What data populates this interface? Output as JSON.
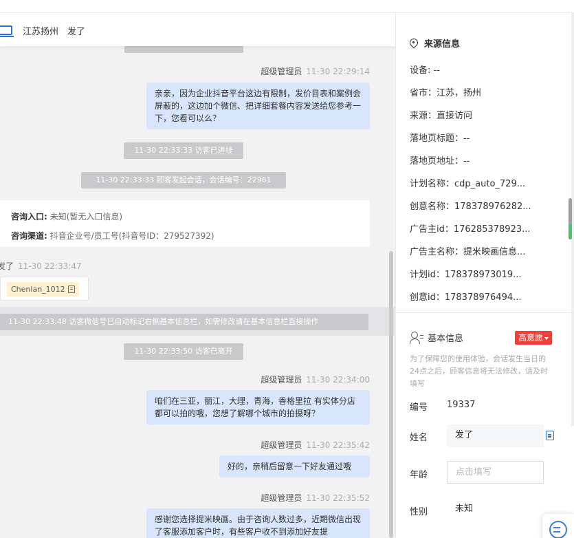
{
  "chat": {
    "header": {
      "source": "江苏扬州",
      "name": "发了"
    },
    "messages": [
      {
        "sender": "超级管理员",
        "time": "11-30 22:29:14",
        "text": "亲亲，因为企业抖音平台这边有限制，发价目表和案例会屏蔽的，这边加个微信、把详细套餐内容发送给您参考一下，您看可以么？"
      },
      {
        "sender": "超级管理员",
        "time": "11-30 22:34:00",
        "text": "咱们在三亚，丽江，大理，青海，香格里拉 有实体分店都可以拍的哦，您想了解哪个城市的拍摄呀？"
      },
      {
        "sender": "超级管理员",
        "time": "11-30 22:35:42",
        "text": "好的，亲稍后留意一下好友通过哦"
      },
      {
        "sender": "超级管理员",
        "time": "11-30 22:35:52",
        "text": "感谢您选择提米映画。由于咨询人数过多，近期微信出现了客服添加客户时，有些客户收不到添加好友提"
      }
    ],
    "system": {
      "visitor_online": "11-30 22:33:33 访客已进线",
      "session_start": "11-30 22:33:33 顾客发起会话，会话编号：22961",
      "wechat_notice": "11-30 22:33:48 访客微信号已自动标记右侧基本信息栏，如需修改请在基本信息栏直接操作",
      "visitor_left": "11-30 22:33:50 访客已离开"
    },
    "info_card": {
      "entry_label": "咨询入口:",
      "entry_value": "未知(暂无入口信息)",
      "channel_label": "咨询渠道:",
      "channel_value": "抖音企业号/员工号(抖音号ID：279527392)"
    },
    "visitor_message": {
      "sender": "发了",
      "time": "11-30 22:33:47",
      "tag": "Chenlan_1012"
    }
  },
  "source_info": {
    "title": "来源信息",
    "rows": [
      "设备: --",
      "省市：江苏，扬州",
      "来源：直接访问",
      "落地页标题：--",
      "落地页地址：--",
      "计划名称：cdp_auto_729...",
      "创意名称：178378976282...",
      "广告主id：176285378923...",
      "广告主名称：提米映画信息...",
      "计划id：178378973019...",
      "创意id：178378976494..."
    ]
  },
  "basic_info": {
    "title": "基本信息",
    "intent_badge": "高意愿",
    "hint": "为了保障您的使用体验，会话发生当日的24点之后，顾客信息将无法修改，请及时填写",
    "id_label": "编号",
    "id_value": "19337",
    "name_label": "姓名",
    "name_value": "发了",
    "age_label": "年龄",
    "age_placeholder": "点击填写",
    "gender_label": "性别",
    "gender_value": "未知"
  },
  "colors": {
    "accent": "#2e6fd9",
    "bubble": "#d7e6fd",
    "system_bubble": "#c9c9cc",
    "intent_red": "#f1403a"
  }
}
